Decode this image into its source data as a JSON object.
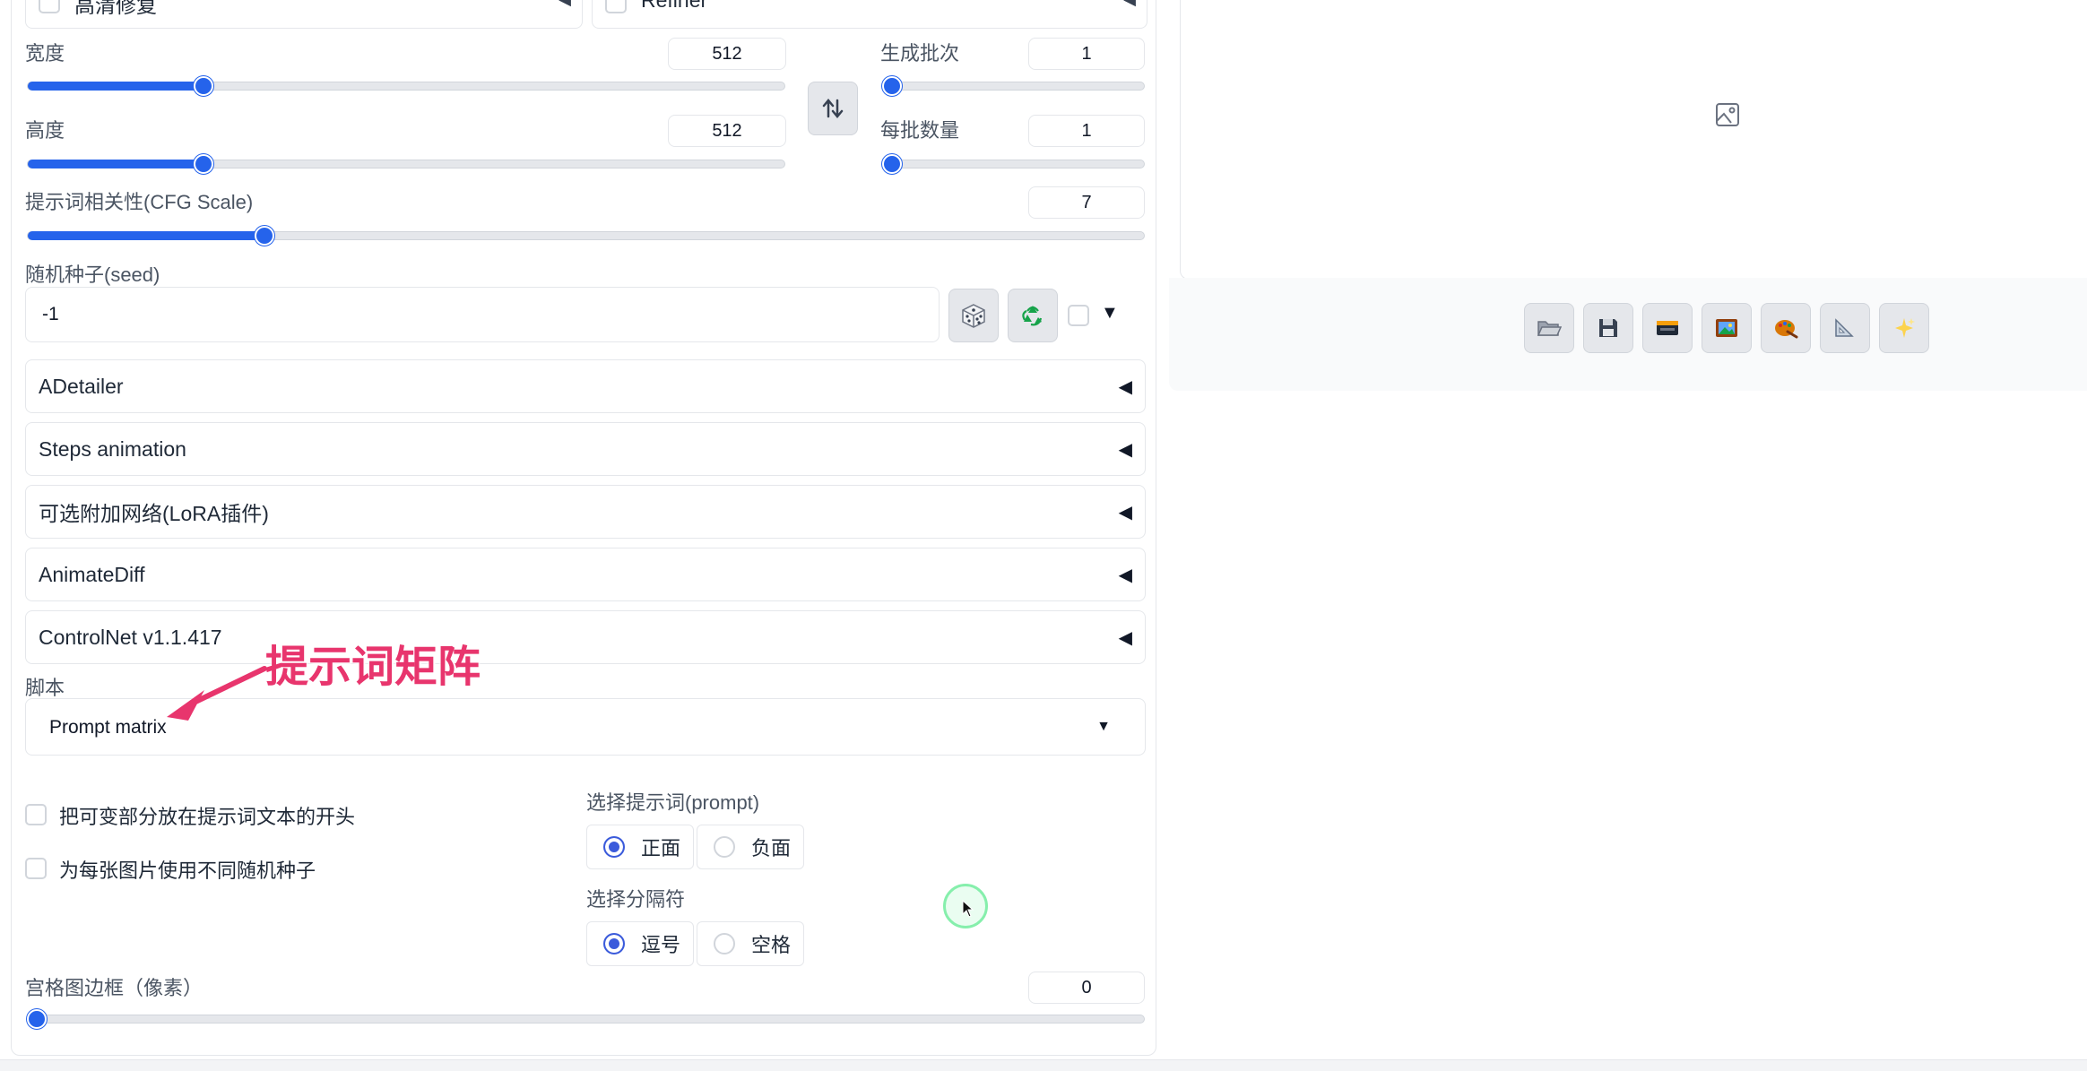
{
  "top_row": {
    "hires_label": "高清修复",
    "refiner_label": "Refiner"
  },
  "width": {
    "label": "宽度",
    "value": "512",
    "level": 0.23
  },
  "height": {
    "label": "高度",
    "value": "512",
    "level": 0.23
  },
  "batch_count": {
    "label": "生成批次",
    "value": "1",
    "level": 0.0
  },
  "batch_size": {
    "label": "每批数量",
    "value": "1",
    "level": 0.0
  },
  "cfg": {
    "label": "提示词相关性(CFG Scale)",
    "value": "7",
    "level": 0.21
  },
  "seed": {
    "label": "随机种子(seed)",
    "value": "-1"
  },
  "accordions": [
    {
      "label": "ADetailer"
    },
    {
      "label": "Steps animation"
    },
    {
      "label": "可选附加网络(LoRA插件)"
    },
    {
      "label": "AnimateDiff"
    },
    {
      "label": "ControlNet v1.1.417"
    }
  ],
  "annotation": {
    "text": "提示词矩阵",
    "color": "#e8356d"
  },
  "script": {
    "label": "脚本",
    "selected": "Prompt matrix"
  },
  "options": {
    "put_variable_start": "把可变部分放在提示词文本的开头",
    "different_seeds": "为每张图片使用不同随机种子"
  },
  "prompt_select": {
    "label": "选择提示词(prompt)",
    "choices": [
      "正面",
      "负面"
    ],
    "selected": "正面"
  },
  "separator_select": {
    "label": "选择分隔符",
    "choices": [
      "逗号",
      "空格"
    ],
    "selected": "逗号"
  },
  "grid_margin": {
    "label": "宫格图边框（像素）",
    "value": "0",
    "level": 0.0
  },
  "toolbar_icons": [
    "folder-icon",
    "save-icon",
    "zip-icon",
    "send-to-img2img-icon",
    "send-to-inpaint-icon",
    "send-to-extras-icon",
    "sparkle-icon"
  ],
  "colors": {
    "accent": "#2563eb",
    "radio": "#3b5bdb",
    "annotation": "#e8356d"
  }
}
